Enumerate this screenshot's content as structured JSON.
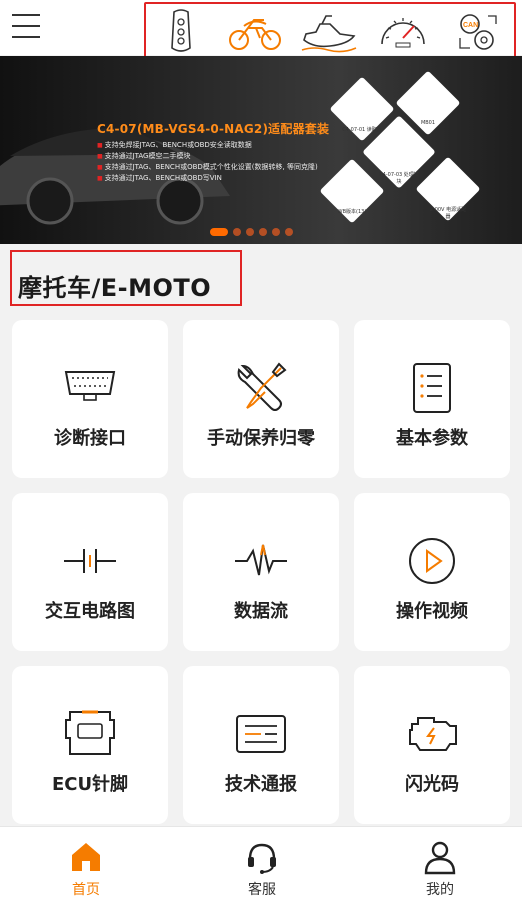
{
  "header": {
    "menu_icon": "hamburger-icon",
    "categories": [
      {
        "name": "car-key",
        "icon": "car-key-icon",
        "active": false
      },
      {
        "name": "motorcycle",
        "icon": "motorcycle-icon",
        "active": true
      },
      {
        "name": "jet-ski",
        "icon": "jet-ski-icon",
        "active": false
      },
      {
        "name": "speedometer",
        "icon": "speedometer-icon",
        "active": false
      },
      {
        "name": "can-bus",
        "icon": "can-gears-icon",
        "active": false,
        "badge": "CAN"
      }
    ]
  },
  "banner": {
    "title": "C4-07(MB-VGS4-0-NAG2)适配器套装",
    "bullets": [
      "支持免焊接JTAG、BENCH或OBD安全读取数据",
      "支持通过JTAG模空二手模块",
      "支持通过JTAG、BENCH或OBD模式个性化设置(数据转移, 等同克隆)",
      "支持通过JTAG、BENCH或OBD写VIN"
    ],
    "module_labels": [
      "C4-07-01 读取器",
      "MB01",
      "C4-07-03 处理模块",
      "WB版本(13)",
      "2.00V 电源适配器"
    ],
    "slide_count": 6,
    "active_slide": 1
  },
  "section": {
    "title": "摩托车/E-MOTO"
  },
  "tiles": [
    {
      "label": "诊断接口",
      "icon": "obd-port-icon"
    },
    {
      "label": "手动保养归零",
      "icon": "wrench-screwdriver-icon"
    },
    {
      "label": "基本参数",
      "icon": "list-document-icon"
    },
    {
      "label": "交互电路图",
      "icon": "circuit-icon"
    },
    {
      "label": "数据流",
      "icon": "waveform-icon"
    },
    {
      "label": "操作视频",
      "icon": "play-circle-icon"
    },
    {
      "label": "ECU针脚",
      "icon": "ecu-connector-icon"
    },
    {
      "label": "技术通报",
      "icon": "bulletin-icon"
    },
    {
      "label": "闪光码",
      "icon": "engine-flash-icon"
    }
  ],
  "tabbar": {
    "tabs": [
      {
        "label": "首页",
        "icon": "home-icon",
        "active": true
      },
      {
        "label": "客服",
        "icon": "headset-icon",
        "active": false
      },
      {
        "label": "我的",
        "icon": "user-icon",
        "active": false
      }
    ]
  },
  "colors": {
    "accent": "#f57c00",
    "highlight_border": "#e02424",
    "background": "#f2f2f2"
  }
}
